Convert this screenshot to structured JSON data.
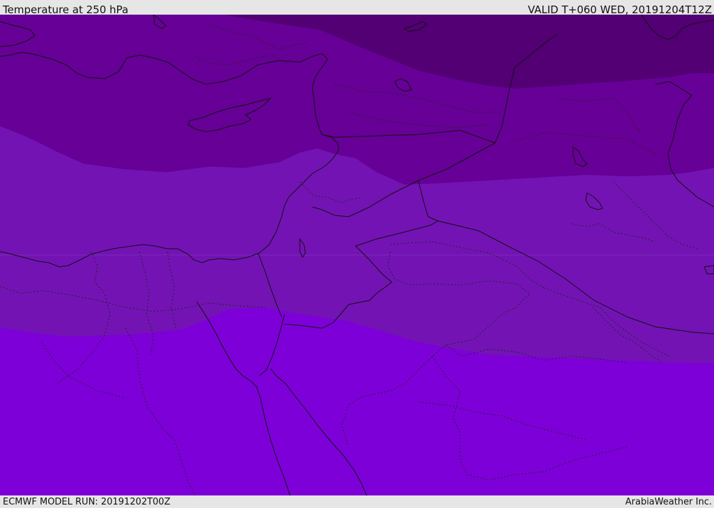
{
  "header": {
    "title": "Temperature at 250 hPa",
    "valid_time": "VALID T+060 WED, 20191204T12Z"
  },
  "footer": {
    "model_run": "ECMWF MODEL RUN: 20191202T00Z",
    "credit": "ArabiaWeather Inc."
  },
  "map": {
    "bands": [
      {
        "name": "coldest",
        "color": "#520074"
      },
      {
        "name": "cold",
        "color": "#660096"
      },
      {
        "name": "mid",
        "color": "#7313b4"
      },
      {
        "name": "warm",
        "color": "#7d00d8"
      }
    ],
    "border_color": "#111111"
  }
}
